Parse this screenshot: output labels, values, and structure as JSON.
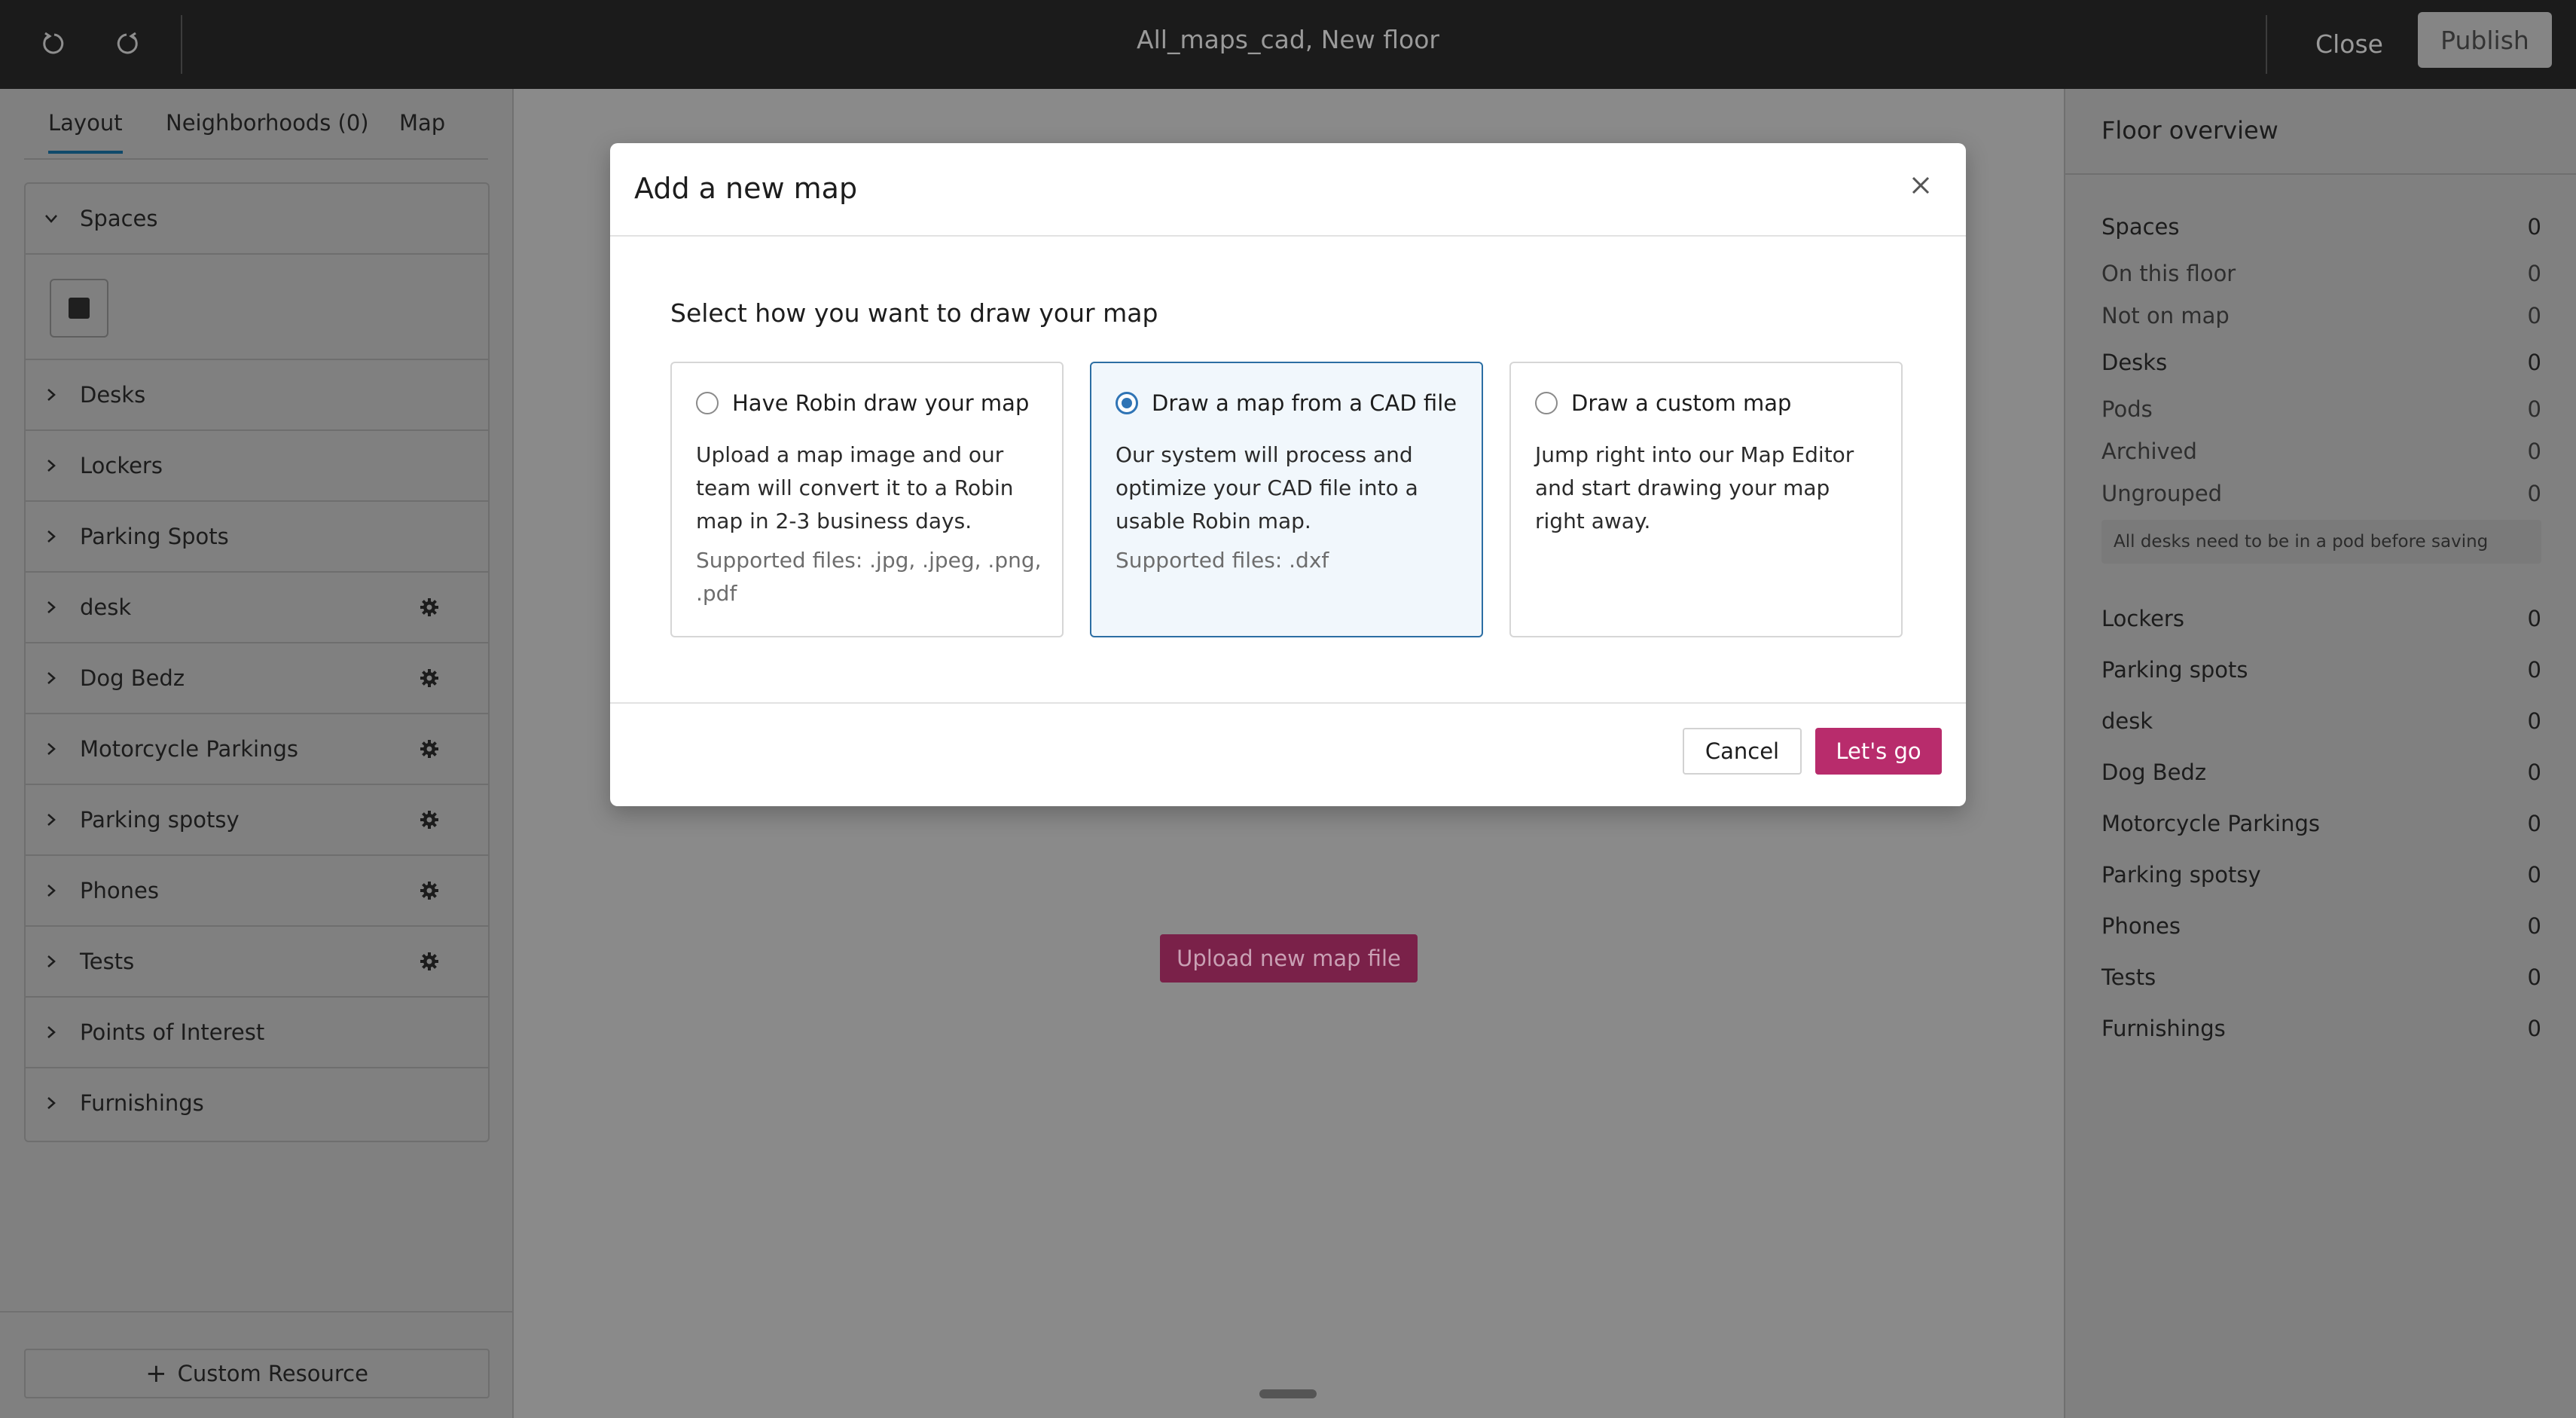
{
  "topbar": {
    "title": "All_maps_cad, New floor",
    "undo_icon": "undo-icon",
    "redo_icon": "redo-icon",
    "close_label": "Close",
    "publish_label": "Publish"
  },
  "left": {
    "tabs": [
      "Layout",
      "Neighborhoods (0)",
      "Map"
    ],
    "active_tab": "Layout",
    "sections": [
      {
        "label": "Spaces",
        "expanded": true,
        "gear": false
      },
      {
        "label": "Desks",
        "gear": false
      },
      {
        "label": "Lockers",
        "gear": false
      },
      {
        "label": "Parking Spots",
        "gear": false
      },
      {
        "label": "desk",
        "gear": true
      },
      {
        "label": "Dog Bedz",
        "gear": true
      },
      {
        "label": "Motorcycle Parkings",
        "gear": true
      },
      {
        "label": "Parking spotsy",
        "gear": true
      },
      {
        "label": "Phones",
        "gear": true
      },
      {
        "label": "Tests",
        "gear": true
      },
      {
        "label": "Points of Interest",
        "gear": false
      },
      {
        "label": "Furnishings",
        "gear": false
      }
    ],
    "custom_resource_label": "Custom Resource"
  },
  "center": {
    "upload_label": "Upload new map file"
  },
  "right": {
    "title": "Floor overview",
    "stats": [
      {
        "label": "Spaces",
        "value": "0",
        "sub": false
      },
      {
        "label": "On this floor",
        "value": "0",
        "sub": true
      },
      {
        "label": "Not on map",
        "value": "0",
        "sub": true
      },
      {
        "label": "Desks",
        "value": "0",
        "sub": false
      },
      {
        "label": "Pods",
        "value": "0",
        "sub": true
      },
      {
        "label": "Archived",
        "value": "0",
        "sub": true
      },
      {
        "label": "Ungrouped",
        "value": "0",
        "sub": true
      }
    ],
    "note": "All desks need to be in a pod before saving",
    "resources": [
      {
        "label": "Lockers",
        "value": "0"
      },
      {
        "label": "Parking spots",
        "value": "0"
      },
      {
        "label": "desk",
        "value": "0"
      },
      {
        "label": "Dog Bedz",
        "value": "0"
      },
      {
        "label": "Motorcycle Parkings",
        "value": "0"
      },
      {
        "label": "Parking spotsy",
        "value": "0"
      },
      {
        "label": "Phones",
        "value": "0"
      },
      {
        "label": "Tests",
        "value": "0"
      },
      {
        "label": "Furnishings",
        "value": "0"
      }
    ]
  },
  "modal": {
    "title": "Add a new map",
    "prompt": "Select how you want to draw your map",
    "options": [
      {
        "title": "Have Robin draw your map",
        "desc": "Upload a map image and our team will convert it to a Robin map in 2-3 business days.",
        "files": "Supported files: .jpg, .jpeg, .png, .pdf",
        "selected": false
      },
      {
        "title": "Draw a map from a CAD file",
        "desc": "Our system will process and optimize your CAD file into a usable Robin map.",
        "files": "Supported files: .dxf",
        "selected": true
      },
      {
        "title": "Draw a custom map",
        "desc": "Jump right into our Map Editor and start drawing your map right away.",
        "files": "",
        "selected": false
      }
    ],
    "cancel_label": "Cancel",
    "confirm_label": "Let's go",
    "accent_color": "#b82c6c",
    "selected_color": "#2f74b5"
  }
}
